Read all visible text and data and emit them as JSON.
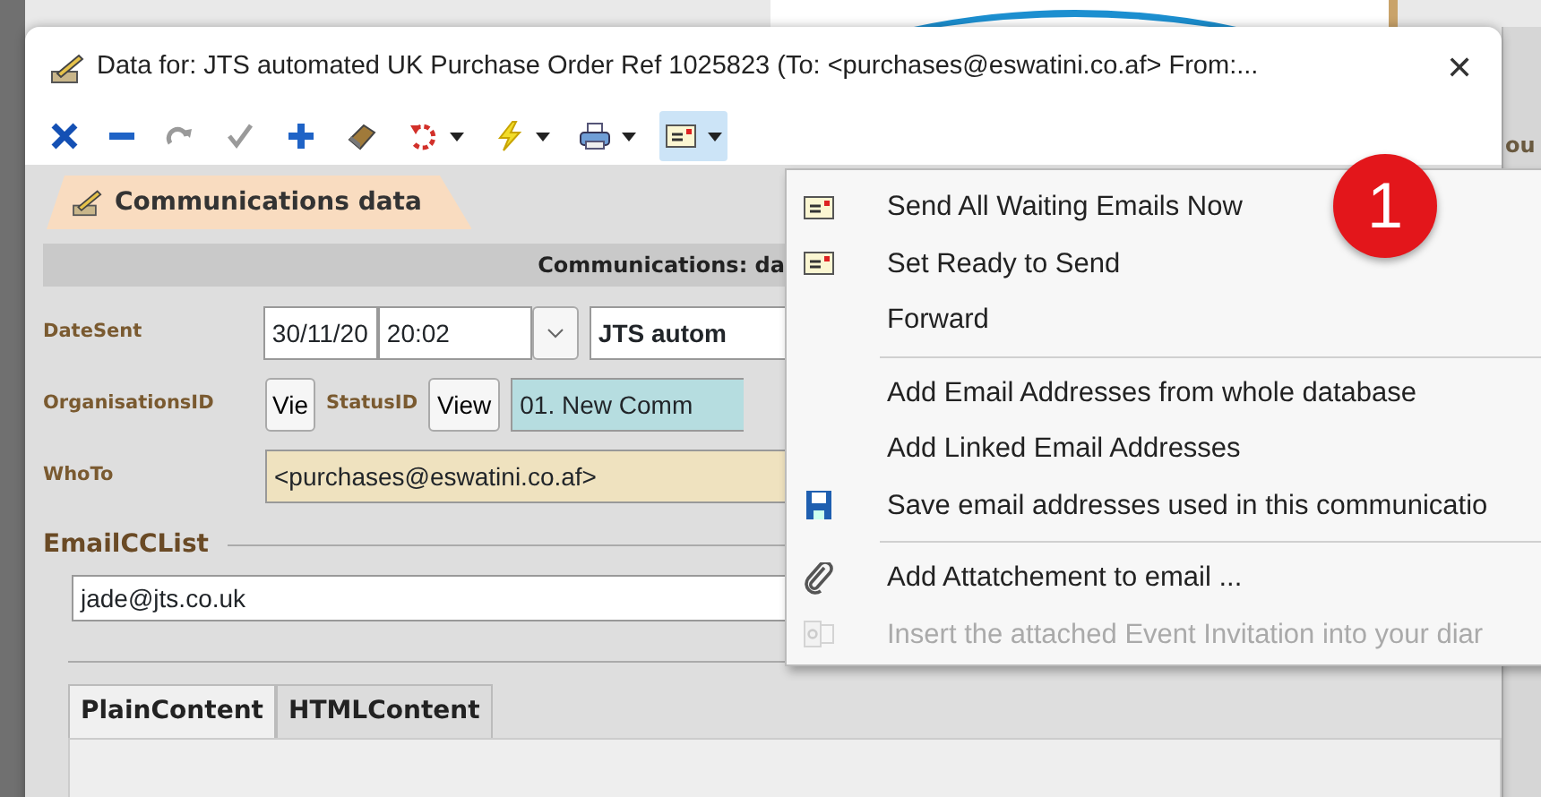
{
  "background": {
    "fragment": "ou"
  },
  "window": {
    "title": "Data for: JTS automated UK Purchase Order Ref 1025823 (To: <purchases@eswatini.co.af> From:...",
    "close": "✕"
  },
  "toolbar": [
    {
      "kind": "delete",
      "disabled": false,
      "dropdown": false,
      "selected": false
    },
    {
      "kind": "minus",
      "disabled": false,
      "dropdown": false,
      "selected": false
    },
    {
      "kind": "redo",
      "disabled": true,
      "dropdown": false,
      "selected": false
    },
    {
      "kind": "check",
      "disabled": true,
      "dropdown": false,
      "selected": false
    },
    {
      "kind": "plus",
      "disabled": false,
      "dropdown": false,
      "selected": false
    },
    {
      "kind": "eraser",
      "disabled": false,
      "dropdown": false,
      "selected": false
    },
    {
      "kind": "undo",
      "disabled": false,
      "dropdown": true,
      "selected": false
    },
    {
      "kind": "lightning",
      "disabled": false,
      "dropdown": true,
      "selected": false
    },
    {
      "kind": "printer",
      "disabled": false,
      "dropdown": true,
      "selected": false
    },
    {
      "kind": "envelope",
      "disabled": false,
      "dropdown": true,
      "selected": true
    }
  ],
  "page_tab": {
    "label": "Communications data"
  },
  "form": {
    "header": "Communications: da",
    "date_label": "DateSent",
    "date": "30/11/20",
    "time": "20:02",
    "subject": "JTS autom",
    "org_label": "OrganisationsID",
    "org_view": "Vie",
    "status_label": "StatusID",
    "status_view": "View",
    "status": "01. New Comm",
    "whoto_label": "WhoTo",
    "whoto": "<purchases@eswatini.co.af>",
    "cc_label": "EmailCCList",
    "cc": "jade@jts.co.uk"
  },
  "content_tabs": [
    {
      "label": "PlainContent",
      "selected": true
    },
    {
      "label": "HTMLContent",
      "selected": false
    }
  ],
  "menu": {
    "groups": [
      [
        {
          "kind": "envelope",
          "label": "Send All Waiting Emails Now",
          "disabled": false
        },
        {
          "kind": "envelope",
          "label": "Set Ready to Send",
          "disabled": false
        },
        {
          "kind": "plain",
          "label": "Forward",
          "disabled": false
        }
      ],
      [
        {
          "kind": "plain",
          "label": "Add Email Addresses from whole database",
          "disabled": false
        },
        {
          "kind": "plain",
          "label": "Add Linked Email Addresses",
          "disabled": false
        },
        {
          "kind": "save",
          "label": "Save email addresses used in this communicatio",
          "disabled": false
        }
      ],
      [
        {
          "kind": "attach",
          "label": "Add Attatchement to email ...",
          "disabled": false
        },
        {
          "kind": "calendar",
          "label": "Insert the attached Event Invitation into your diar",
          "disabled": true
        }
      ]
    ]
  },
  "callout": {
    "label": "1"
  }
}
